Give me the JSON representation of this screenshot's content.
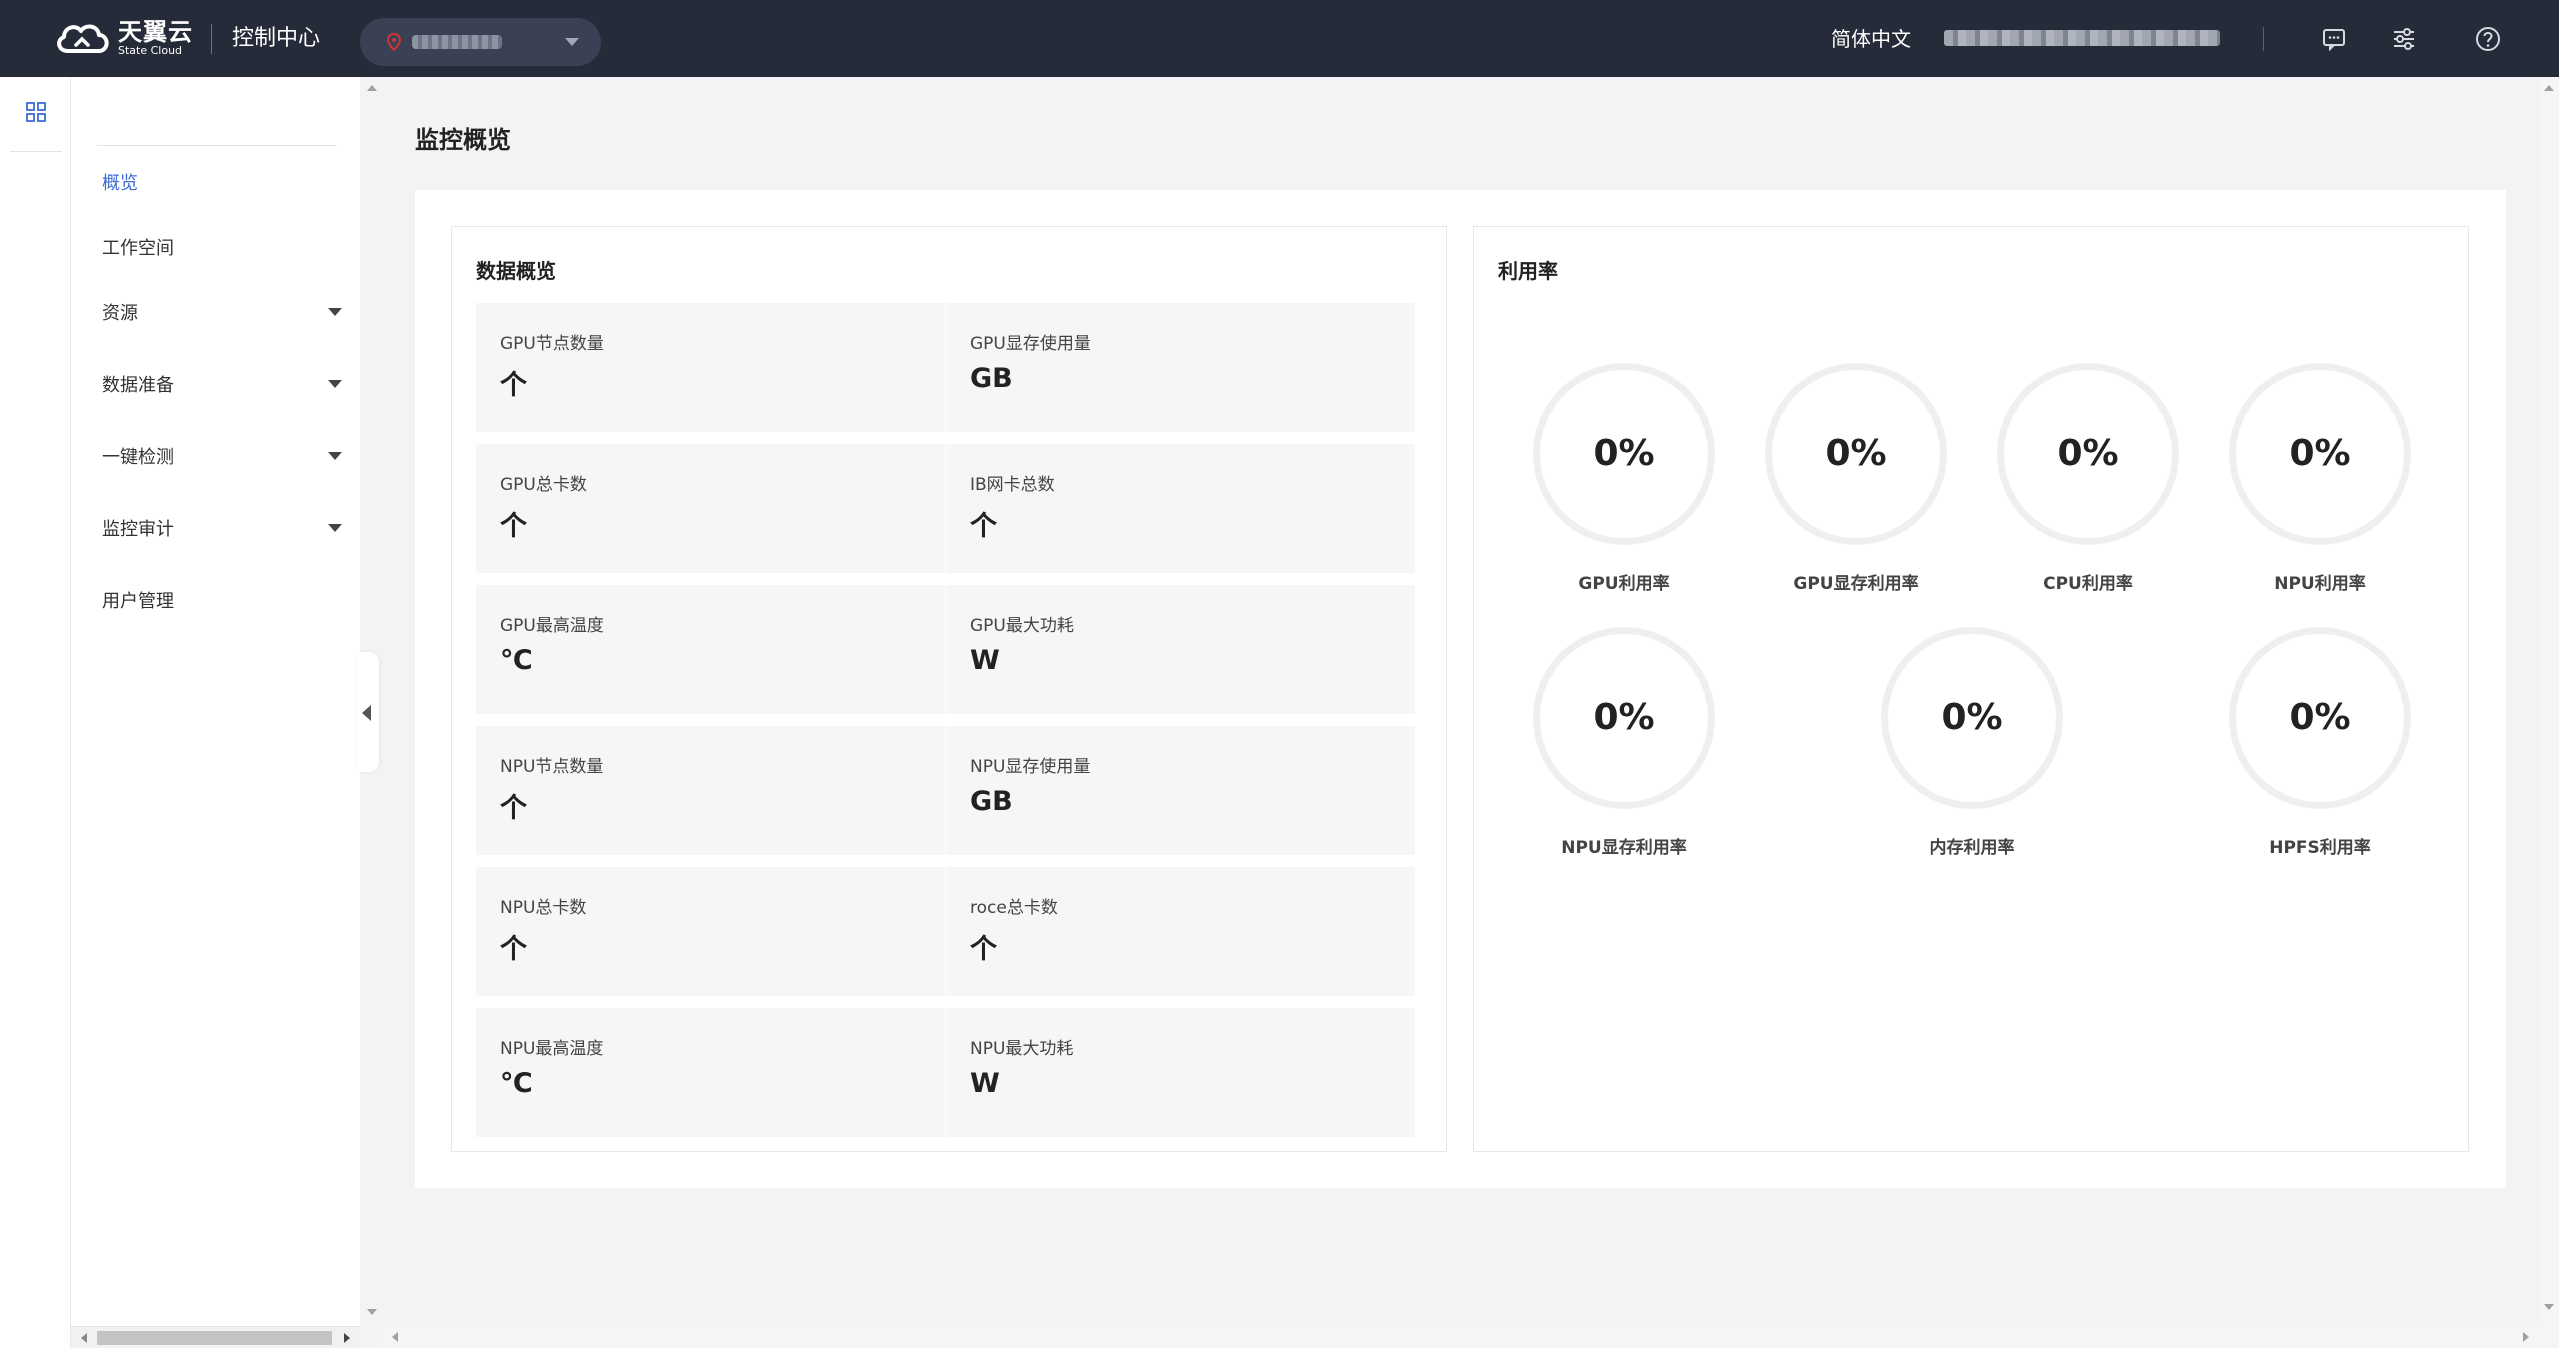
{
  "header": {
    "logo_cn": "天翼云",
    "logo_en": "State Cloud",
    "console_title": "控制中心",
    "region_value": "",
    "language": "简体中文",
    "account": ""
  },
  "sidebar": {
    "items": [
      {
        "label": "概览",
        "active": true,
        "expandable": false
      },
      {
        "label": "工作空间",
        "active": false,
        "expandable": false
      },
      {
        "label": "资源",
        "active": false,
        "expandable": true
      },
      {
        "label": "数据准备",
        "active": false,
        "expandable": true
      },
      {
        "label": "一键检测",
        "active": false,
        "expandable": true
      },
      {
        "label": "监控审计",
        "active": false,
        "expandable": true
      },
      {
        "label": "用户管理",
        "active": false,
        "expandable": false
      }
    ]
  },
  "main": {
    "title": "监控概览",
    "overview": {
      "title": "数据概览",
      "stats": [
        {
          "label": "GPU节点数量",
          "unit": "个"
        },
        {
          "label": "GPU显存使用量",
          "unit": "GB"
        },
        {
          "label": "GPU总卡数",
          "unit": "个"
        },
        {
          "label": "IB网卡总数",
          "unit": "个"
        },
        {
          "label": "GPU最高温度",
          "unit": "℃"
        },
        {
          "label": "GPU最大功耗",
          "unit": "W"
        },
        {
          "label": "NPU节点数量",
          "unit": "个"
        },
        {
          "label": "NPU显存使用量",
          "unit": "GB"
        },
        {
          "label": "NPU总卡数",
          "unit": "个"
        },
        {
          "label": "roce总卡数",
          "unit": "个"
        },
        {
          "label": "NPU最高温度",
          "unit": "℃"
        },
        {
          "label": "NPU最大功耗",
          "unit": "W"
        }
      ]
    },
    "utilization": {
      "title": "利用率",
      "gauges": [
        {
          "label": "GPU利用率",
          "value": "0%"
        },
        {
          "label": "GPU显存利用率",
          "value": "0%"
        },
        {
          "label": "CPU利用率",
          "value": "0%"
        },
        {
          "label": "NPU利用率",
          "value": "0%"
        },
        {
          "label": "NPU显存利用率",
          "value": "0%"
        },
        {
          "label": "内存利用率",
          "value": "0%"
        },
        {
          "label": "HPFS利用率",
          "value": "0%"
        }
      ]
    }
  },
  "colors": {
    "topbar": "#262b39",
    "accent": "#3e6bd6",
    "page_bg": "#f2f3f5",
    "stat_bg": "#f5f6f8",
    "region_icon": "#d0343b"
  },
  "icons": {
    "rail": "grid-icon",
    "region": "location-pin-icon",
    "top": [
      "message-icon",
      "settings-sliders-icon",
      "help-icon"
    ]
  }
}
